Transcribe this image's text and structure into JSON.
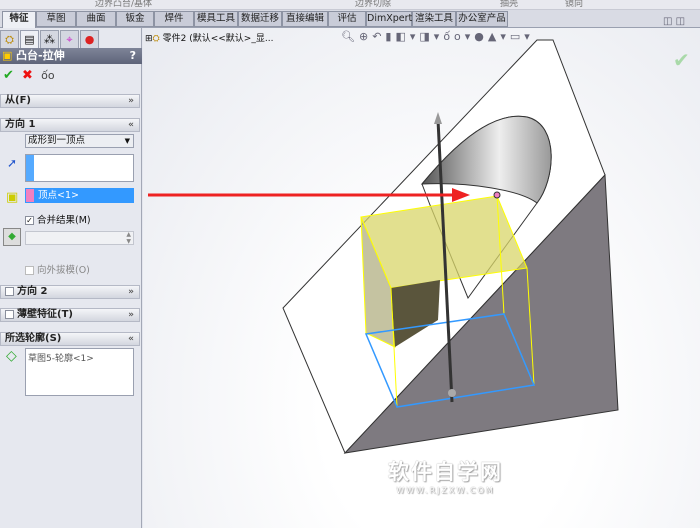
{
  "top_toolbar": [
    "边界凸台/基体",
    "边界切除",
    "抽壳",
    "镜向"
  ],
  "tabs": [
    "特征",
    "草图",
    "曲面",
    "钣金",
    "焊件",
    "模具工具",
    "数据迁移",
    "直接编辑",
    "评估",
    "DimXpert",
    "渲染工具",
    "办公室产品"
  ],
  "panel": {
    "title": "凸台-拉伸",
    "help": "?",
    "from_label": "从(F)",
    "dir1_label": "方向 1",
    "end_condition": "成形到一顶点",
    "vertex_value": "顶点<1>",
    "merge_label": "合并结果(M)",
    "merge_checked": true,
    "draft_label": "向外拔模(O)",
    "dir2_label": "方向 2",
    "thin_label": "薄壁特征(T)",
    "contours_label": "所选轮廓(S)",
    "contour_item": "草图5-轮廓<1>"
  },
  "viewport": {
    "tree_label": "零件2 (默认<<默认>_显...",
    "watermark": "软件自学网",
    "watermark_url": "WWW.RJZXW.COM"
  },
  "colors": {
    "selection": "#3399ff",
    "arrow": "#ee2222",
    "preview": "#e8e85a"
  }
}
